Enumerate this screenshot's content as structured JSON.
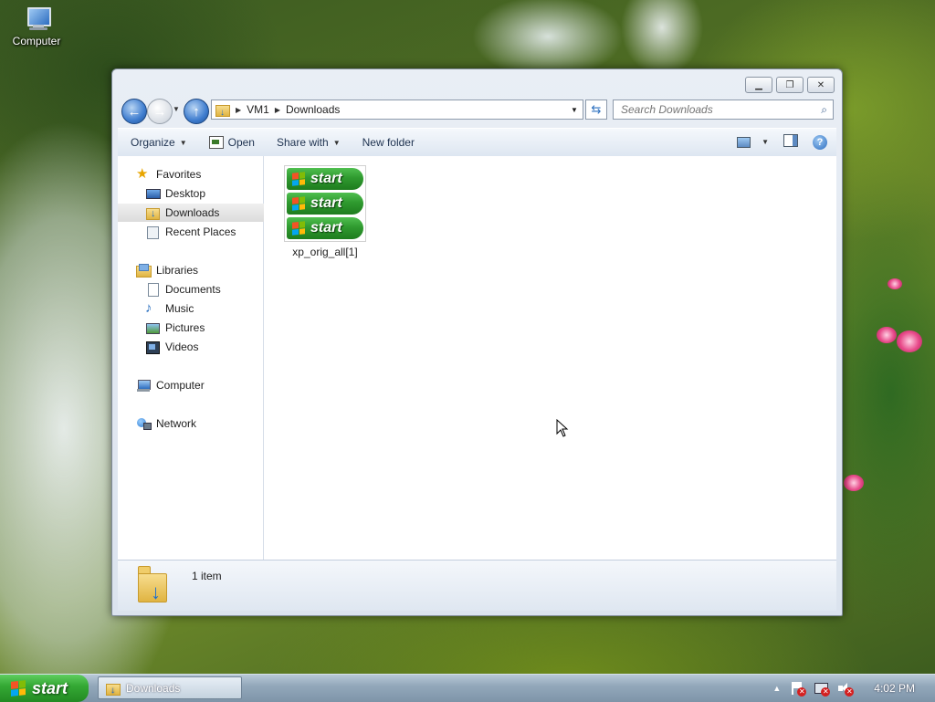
{
  "desktop": {
    "computer_label": "Computer"
  },
  "window": {
    "address": {
      "segments": [
        "VM1",
        "Downloads"
      ]
    },
    "search": {
      "placeholder": "Search Downloads"
    },
    "toolbar": {
      "organize": "Organize",
      "open": "Open",
      "share_with": "Share with",
      "new_folder": "New folder"
    },
    "nav": {
      "favorites": "Favorites",
      "desktop": "Desktop",
      "downloads": "Downloads",
      "recent_places": "Recent Places",
      "libraries": "Libraries",
      "documents": "Documents",
      "music": "Music",
      "pictures": "Pictures",
      "videos": "Videos",
      "computer": "Computer",
      "network": "Network"
    },
    "files": [
      {
        "name": "xp_orig_all[1]",
        "thumb_text": "start"
      }
    ],
    "details": {
      "count": "1 item"
    }
  },
  "taskbar": {
    "start_label": "start",
    "task_label": "Downloads",
    "clock": "4:02 PM"
  },
  "colors": {
    "accent": "#3f7dcf",
    "start_green": "#35a935"
  }
}
